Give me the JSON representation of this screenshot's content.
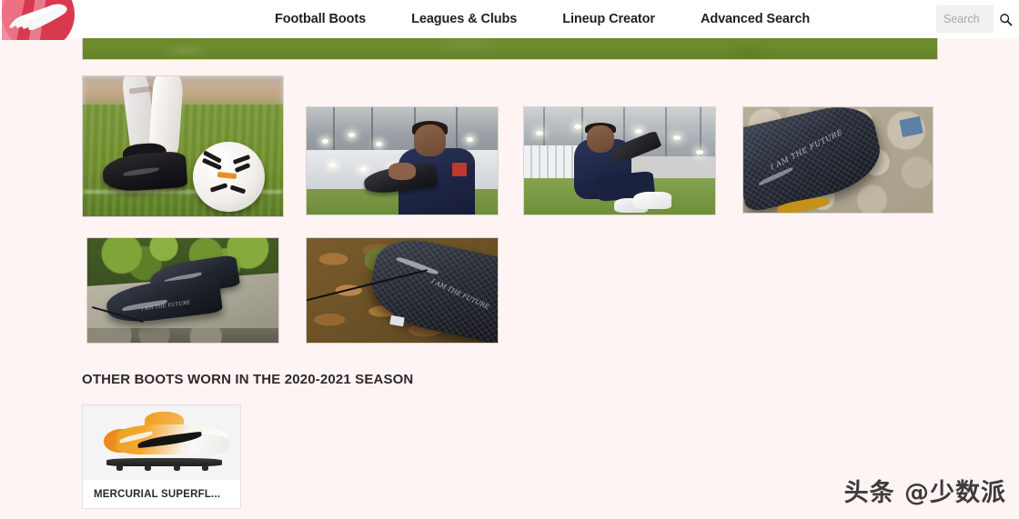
{
  "site": {
    "logo_icon": "football-boot-logo-icon",
    "logo_color": "#d8394f"
  },
  "nav": {
    "items": [
      {
        "label": "Football Boots"
      },
      {
        "label": "Leagues & Clubs"
      },
      {
        "label": "Lineup Creator"
      },
      {
        "label": "Advanced Search"
      }
    ]
  },
  "search": {
    "placeholder": "Search",
    "value": "",
    "icon": "search-icon"
  },
  "banner": {
    "kind": "grass-pitch-banner",
    "color": "#6d8a2c"
  },
  "gallery": {
    "items": [
      {
        "alt": "Black football boot beside white Nike ball on grass pitch"
      },
      {
        "alt": "Player holding black boot inside training dome"
      },
      {
        "alt": "Player sitting on turf holding boots"
      },
      {
        "alt": "Close-up of dark boot on stones with I AM THE FUTURE script",
        "script": "I AM THE FUTURE"
      },
      {
        "alt": "Pair of dark boots on stone slab beside greenery",
        "script": "I AM THE FUTURE"
      },
      {
        "alt": "Dark boot lying on autumn leaves",
        "script": "I AM THE FUTURE"
      }
    ]
  },
  "section": {
    "title": "OTHER BOOTS WORN IN THE 2020-2021 SEASON"
  },
  "products": [
    {
      "name": "MERCURIAL SUPERFL...",
      "alt": "Orange and white Nike Mercurial Superfly boot"
    }
  ],
  "watermark": {
    "text": "头条 @少数派"
  }
}
